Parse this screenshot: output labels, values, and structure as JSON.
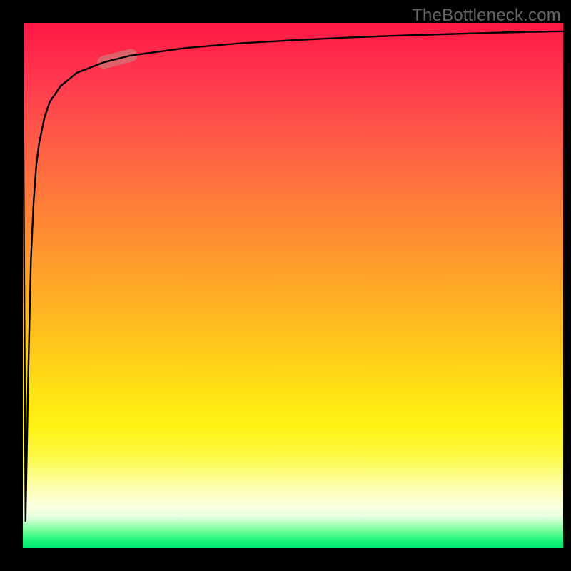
{
  "watermark": "TheBottleneck.com",
  "chart_data": {
    "type": "line",
    "title": "",
    "xlabel": "",
    "ylabel": "",
    "xlim": [
      0,
      100
    ],
    "ylim": [
      0,
      100
    ],
    "grid": false,
    "background_gradient": {
      "stops": [
        {
          "pos": 0.0,
          "color": "#ff1744"
        },
        {
          "pos": 0.5,
          "color": "#ffa828"
        },
        {
          "pos": 0.82,
          "color": "#fdf93f"
        },
        {
          "pos": 0.96,
          "color": "#7bfd9d"
        },
        {
          "pos": 1.0,
          "color": "#00e874"
        }
      ]
    },
    "series": [
      {
        "name": "bottleneck-curve",
        "x": [
          0,
          0.5,
          1,
          1.5,
          2,
          2.5,
          3,
          4,
          5,
          7,
          10,
          15,
          20,
          30,
          40,
          50,
          60,
          70,
          80,
          90,
          100
        ],
        "y": [
          100,
          5,
          33,
          55,
          66,
          73,
          77,
          82,
          85,
          88,
          90.5,
          92.5,
          93.8,
          95.2,
          96.1,
          96.7,
          97.2,
          97.6,
          97.9,
          98.2,
          98.4
        ],
        "color": "#000000"
      }
    ],
    "annotations": [
      {
        "name": "highlight-segment",
        "x_range": [
          14,
          24
        ],
        "color": "#c97f7d",
        "opacity": 0.65
      }
    ]
  }
}
